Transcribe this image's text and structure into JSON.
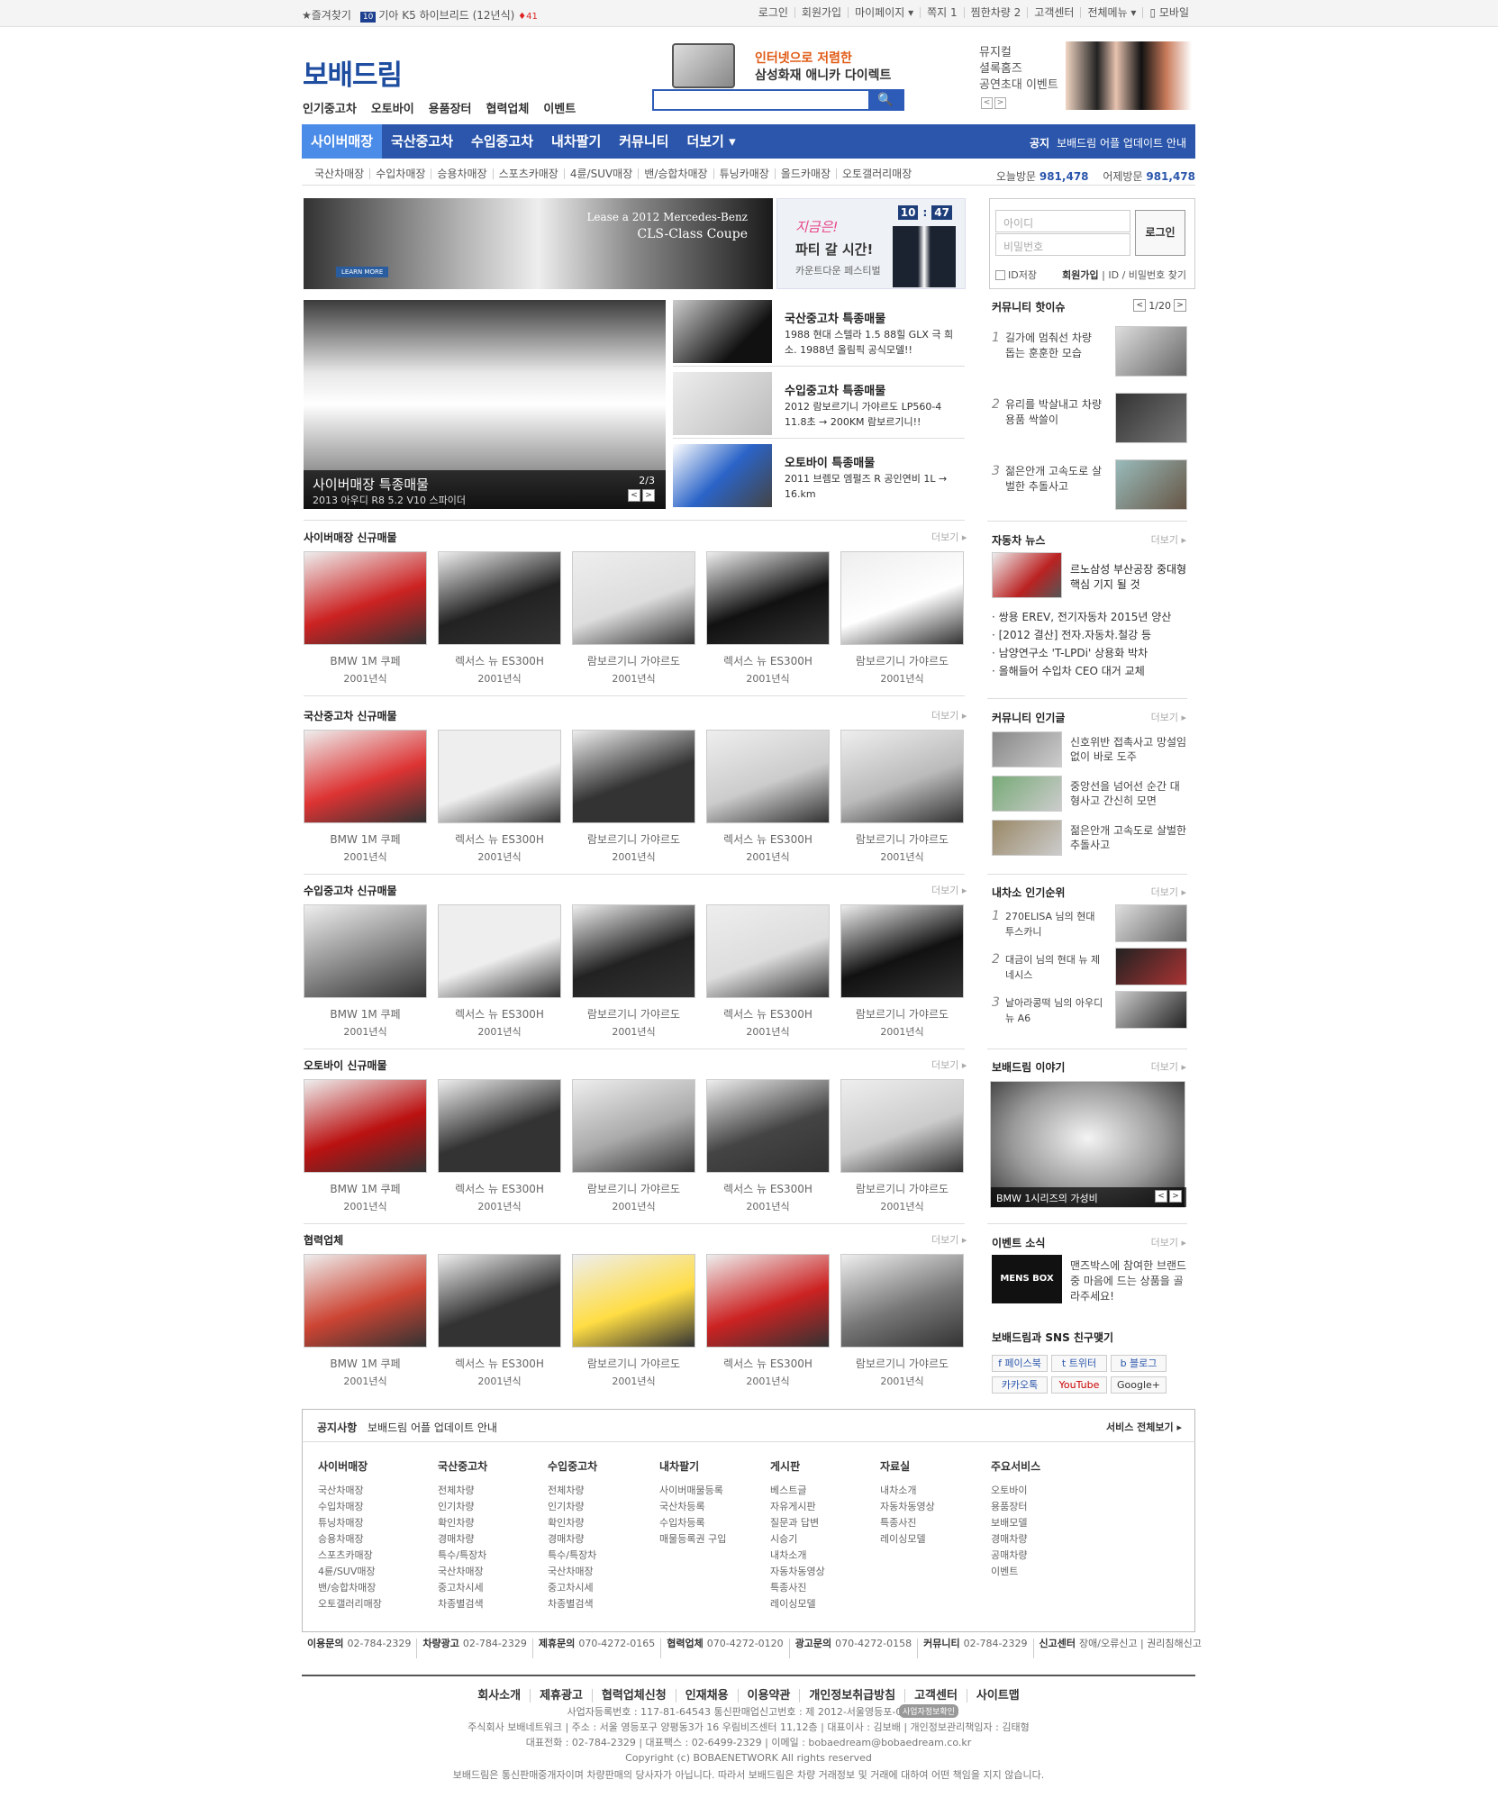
{
  "topbar": {
    "favorites": "★즐겨찾기",
    "ticker_badge": "10",
    "ticker": "기아 K5 하이브리드 (12년식)",
    "ticker_rank": "♦41",
    "links": [
      "로그인",
      "회원가입",
      "마이페이지 ▾",
      "쪽지 1",
      "찜한차량 2",
      "고객센터",
      "전체메뉴 ▾",
      "▯ 모바일"
    ]
  },
  "logo": "보배드림",
  "gnb_top": [
    "인기중고차",
    "오토바이",
    "용품장터",
    "협력업체",
    "이벤트"
  ],
  "search_banner": {
    "line1": "인터넷으로 저렴한",
    "line2": "삼성화재 애니카 다이렉트",
    "button": "🔍"
  },
  "musical": {
    "line1": "뮤지컬",
    "line2": "셜록홈즈",
    "line3": "공연초대 이벤트",
    "prev": "<",
    "next": ">"
  },
  "gnb": {
    "items": [
      "사이버매장",
      "국산중고차",
      "수입중고차",
      "내차팔기",
      "커뮤니티",
      "더보기 ▾"
    ],
    "notice_label": "공지",
    "notice_text": "보배드림 어플 업데이트 안내"
  },
  "subnav": {
    "items": [
      "국산차매장",
      "수입차매장",
      "승용차매장",
      "스포츠카매장",
      "4륜/SUV매장",
      "밴/승합차매장",
      "튜닝카매장",
      "올드카매장",
      "오토갤러리매장"
    ],
    "today_label": "오늘방문",
    "today": "981,478",
    "yesterday_label": "어제방문",
    "yesterday": "981,478"
  },
  "banner1": {
    "line1": "Lease a 2012 Mercedes-Benz",
    "line2": "CLS-Class Coupe",
    "btn": "LEARN MORE"
  },
  "banner2": {
    "line1": "지금은!",
    "line2": "파티 갈 시간!",
    "line3": "카운트다운 페스티벌",
    "clock": [
      "10",
      ":",
      "47"
    ]
  },
  "login": {
    "id_ph": "아이디",
    "pw_ph": "비밀번호",
    "button": "로그인",
    "save": "ID저장",
    "join": "회원가입",
    "find": "ID / 비밀번호 찾기"
  },
  "main_photo": {
    "title": "사이버매장 특종매물",
    "desc": "2013 아우디 R8 5.2 V10 스파이더",
    "page": "2/3",
    "prev": "<",
    "next": ">"
  },
  "sales": [
    {
      "title": "국산중고차 특종매물",
      "desc": "1988 현대 스텔라 1.5 88힐 GLX 극 희소. 1988년 올림픽 공식모델!!"
    },
    {
      "title": "수입중고차 특종매물",
      "desc": "2012 람보르기니 가야르도 LP560-4 11.8초 → 200KM 람보르기니!!"
    },
    {
      "title": "오토바이 특종매물",
      "desc": "2011 브렘모 엠펄즈 R 공인연비 1L → 16.km"
    }
  ],
  "sections": [
    {
      "title": "사이버매장 신규매물",
      "more": "더보기 ▸",
      "items": [
        {
          "name": "BMW 1M 쿠페",
          "year": "2001년식"
        },
        {
          "name": "렉서스 뉴 ES300H",
          "year": "2001년식"
        },
        {
          "name": "람보르기니 가야르도",
          "year": "2001년식"
        },
        {
          "name": "렉서스 뉴 ES300H",
          "year": "2001년식"
        },
        {
          "name": "람보르기니 가야르도",
          "year": "2001년식"
        }
      ]
    },
    {
      "title": "국산중고차 신규매물",
      "more": "더보기 ▸",
      "items": [
        {
          "name": "BMW 1M 쿠페",
          "year": "2001년식"
        },
        {
          "name": "렉서스 뉴 ES300H",
          "year": "2001년식"
        },
        {
          "name": "람보르기니 가야르도",
          "year": "2001년식"
        },
        {
          "name": "렉서스 뉴 ES300H",
          "year": "2001년식"
        },
        {
          "name": "람보르기니 가야르도",
          "year": "2001년식"
        }
      ]
    },
    {
      "title": "수입중고차 신규매물",
      "more": "더보기 ▸",
      "items": [
        {
          "name": "BMW 1M 쿠페",
          "year": "2001년식"
        },
        {
          "name": "렉서스 뉴 ES300H",
          "year": "2001년식"
        },
        {
          "name": "람보르기니 가야르도",
          "year": "2001년식"
        },
        {
          "name": "렉서스 뉴 ES300H",
          "year": "2001년식"
        },
        {
          "name": "람보르기니 가야르도",
          "year": "2001년식"
        }
      ]
    },
    {
      "title": "오토바이 신규매물",
      "more": "더보기 ▸",
      "items": [
        {
          "name": "BMW 1M 쿠페",
          "year": "2001년식"
        },
        {
          "name": "렉서스 뉴 ES300H",
          "year": "2001년식"
        },
        {
          "name": "람보르기니 가야르도",
          "year": "2001년식"
        },
        {
          "name": "렉서스 뉴 ES300H",
          "year": "2001년식"
        },
        {
          "name": "람보르기니 가야르도",
          "year": "2001년식"
        }
      ]
    },
    {
      "title": "협력업체",
      "more": "더보기 ▸",
      "items": [
        {
          "name": "BMW 1M 쿠페",
          "year": "2001년식"
        },
        {
          "name": "렉서스 뉴 ES300H",
          "year": "2001년식"
        },
        {
          "name": "람보르기니 가야르도",
          "year": "2001년식"
        },
        {
          "name": "렉서스 뉴 ES300H",
          "year": "2001년식"
        },
        {
          "name": "람보르기니 가야르도",
          "year": "2001년식"
        }
      ]
    }
  ],
  "community_hot": {
    "title": "커뮤니티 핫이슈",
    "page": "1/20",
    "items": [
      {
        "n": "1",
        "t": "길가에 멈춰선 차량 돕는 훈훈한 모습"
      },
      {
        "n": "2",
        "t": "유리를 박살내고 차량용품 싹쓸이"
      },
      {
        "n": "3",
        "t": "젊은안개 고속도로 살벌한 추돌사고"
      }
    ]
  },
  "car_news": {
    "title": "자동차 뉴스",
    "more": "더보기 ▸",
    "headline": "르노삼성 부산공장 중대형 핵심 기지 될 것",
    "list": [
      "· 쌍용 EREV, 전기자동차 2015년 양산",
      "· [2012 결산] 전자.자동차.철강 등",
      "· 남양연구소 'T-LPDi' 상용화 박차",
      "· 올해들어 수입차 CEO 대거 교체"
    ]
  },
  "community_pop": {
    "title": "커뮤니티 인기글",
    "more": "더보기 ▸",
    "items": [
      "신호위반 접촉사고 망설임 없이 바로 도주",
      "중앙선을 넘어선 순간 대형사고 간신히 모면",
      "젊은안개 고속도로 살벌한 추돌사고"
    ]
  },
  "mycar_rank": {
    "title": "내차소 인기순위",
    "more": "더보기 ▸",
    "items": [
      {
        "n": "1",
        "t": "270ELISA 님의 현대 투스카니"
      },
      {
        "n": "2",
        "t": "대금이 님의 현대 뉴 제네시스"
      },
      {
        "n": "3",
        "t": "날아라콩떡 님의 아우디 뉴 A6"
      }
    ]
  },
  "story": {
    "title": "보배드림 이야기",
    "more": "더보기 ▸",
    "caption": "BMW 1시리즈의 가성비"
  },
  "event": {
    "title": "이벤트 소식",
    "more": "더보기 ▸",
    "img_text": "MENS BOX",
    "text": "맨즈박스에 참여한 브랜드 중 마음에 드는 상품을 골라주세요!"
  },
  "sns": {
    "title": "보배드림과 SNS 친구맺기",
    "items": [
      "f 페이스북",
      "t 트위터",
      "b 블로그",
      "카카오톡",
      "YouTube",
      "Google+"
    ]
  },
  "foot_notice": {
    "label": "공지사항",
    "text": "보배드림 어플 업데이트 안내",
    "all": "서비스 전체보기 ▸"
  },
  "sitemap": [
    {
      "h": "사이버매장",
      "items": [
        "국산차매장",
        "수입차매장",
        "튜닝차매장",
        "승용차매장",
        "스포츠카매장",
        "4륜/SUV매장",
        "밴/승합차매장",
        "오토갤러리매장"
      ]
    },
    {
      "h": "국산중고차",
      "items": [
        "전체차량",
        "인기차량",
        "확인차량",
        "경매차량",
        "특수/특장차",
        "국산차매장",
        "중고차시세",
        "차종별검색"
      ]
    },
    {
      "h": "수입중고차",
      "items": [
        "전체차량",
        "인기차량",
        "확인차량",
        "경매차량",
        "특수/특장차",
        "국산차매장",
        "중고차시세",
        "차종별검색"
      ]
    },
    {
      "h": "내차팔기",
      "items": [
        "사이버매물등록",
        "국산차등록",
        "수입차등록",
        "매물등록권 구입"
      ]
    },
    {
      "h": "게시판",
      "items": [
        "베스트글",
        "자유게시판",
        "질문과 답변",
        "시승기",
        "내차소개",
        "자동차동영상",
        "특종사진",
        "레이싱모델"
      ]
    },
    {
      "h": "자료실",
      "items": [
        "내차소개",
        "자동차동영상",
        "특종사진",
        "레이싱모델"
      ]
    },
    {
      "h": "주요서비스",
      "items": [
        "오토바이",
        "용품장터",
        "보배모델",
        "경매차량",
        "공매차량",
        "이벤트"
      ]
    }
  ],
  "contacts": [
    {
      "k": "이용문의",
      "v": "02-784-2329"
    },
    {
      "k": "차량광고",
      "v": "02-784-2329"
    },
    {
      "k": "제휴문의",
      "v": "070-4272-0165"
    },
    {
      "k": "협력업체",
      "v": "070-4272-0120"
    },
    {
      "k": "광고문의",
      "v": "070-4272-0158"
    },
    {
      "k": "커뮤니티",
      "v": "02-784-2329"
    },
    {
      "k": "신고센터",
      "v": "장애/오류신고 | 권리침해신고"
    }
  ],
  "footer_links": [
    "회사소개",
    "제휴광고",
    "협력업체신청",
    "인재채용",
    "이용약관",
    "개인정보취급방침",
    "고객센터",
    "사이트맵"
  ],
  "footer_info": [
    "사업자등록번호 : 117-81-64543 통신판매업신고번호 : 제 2012-서울영등포-0697호",
    "주식회사 보배네트워크 | 주소 : 서울 영등포구 양평동3가 16 우림비즈센터 11,12층 | 대표이사 : 김보배 | 개인정보관리책임자 : 김태형",
    "대표전화 : 02-784-2329 | 대표팩스 : 02-6499-2329 | 이메일 : bobaedream@bobaedream.co.kr",
    "Copyright (c) BOBAENETWORK All rights reserved"
  ],
  "footer_badge": "사업자정보확인",
  "disclaimer": "보배드림은 통신판매중개자이며 차량판매의 당사자가 아닙니다. 따라서 보배드림은 차량 거래정보 및 거래에 대하여 어떤 책임을 지지 않습니다."
}
